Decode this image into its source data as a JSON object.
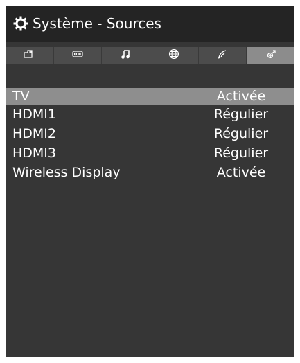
{
  "header": {
    "icon": "gear-icon",
    "title": "Système - Sources"
  },
  "tabs": [
    {
      "icon": "picture-icon",
      "active": false
    },
    {
      "icon": "sound-settings-icon",
      "active": false
    },
    {
      "icon": "music-note-icon",
      "active": false
    },
    {
      "icon": "globe-icon",
      "active": false
    },
    {
      "icon": "satellite-icon",
      "active": false
    },
    {
      "icon": "system-icon",
      "active": true
    }
  ],
  "sources": [
    {
      "name": "TV",
      "value": "Activée",
      "selected": true
    },
    {
      "name": "HDMI1",
      "value": "Régulier",
      "selected": false
    },
    {
      "name": "HDMI2",
      "value": "Régulier",
      "selected": false
    },
    {
      "name": "HDMI3",
      "value": "Régulier",
      "selected": false
    },
    {
      "name": "Wireless Display",
      "value": "Activée",
      "selected": false
    }
  ],
  "colors": {
    "panel": "#363636",
    "header": "#242424",
    "tab": "#4c4c4c",
    "tab_active": "#8c8c8c",
    "selected_row": "#8e8e8e"
  }
}
